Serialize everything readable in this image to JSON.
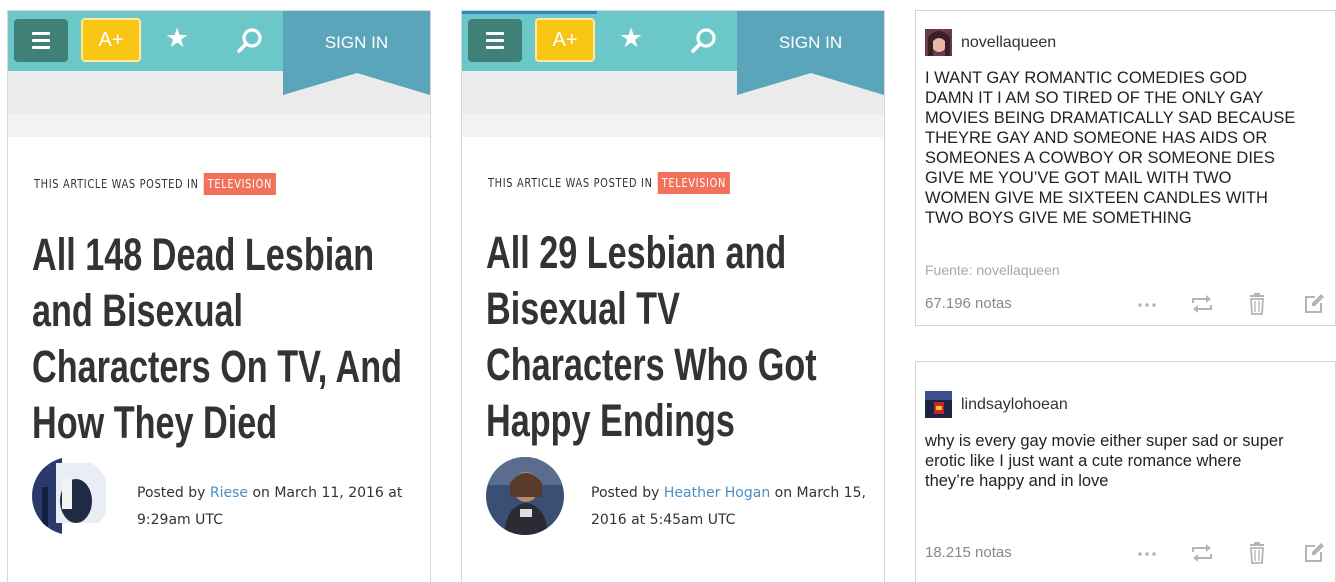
{
  "articles": [
    {
      "nav": {
        "aplus_label": "A+",
        "signin_label": "SIGN IN"
      },
      "posted_in_label": "THIS ARTICLE WAS POSTED IN",
      "category": "TELEVISION",
      "title_lines": [
        "All 148 Dead Lesbian",
        "and Bisexual",
        "Characters On TV, And",
        "How They Died"
      ],
      "byline": {
        "prefix": "Posted by ",
        "author": "Riese",
        "suffix": " on March 11, 2016 at 9:29am UTC"
      }
    },
    {
      "nav": {
        "aplus_label": "A+",
        "signin_label": "SIGN IN"
      },
      "posted_in_label": "THIS ARTICLE WAS POSTED IN",
      "category": "TELEVISION",
      "title_lines": [
        "All 29 Lesbian and",
        "Bisexual TV",
        "Characters Who Got",
        "Happy Endings"
      ],
      "byline": {
        "prefix": "Posted by ",
        "author": "Heather Hogan",
        "suffix": " on March 15, 2016 at 5:45am UTC"
      }
    }
  ],
  "posts": [
    {
      "username": "novellaqueen",
      "text_lines": [
        "I WANT GAY ROMANTIC COMEDIES GOD",
        "DAMN IT I AM SO TIRED OF THE ONLY GAY",
        "MOVIES BEING DRAMATICALLY SAD BECAUSE",
        "THEYRE GAY AND SOMEONE HAS AIDS OR",
        "SOMEONES A COWBOY OR SOMEONE DIES",
        "GIVE ME YOU’VE GOT MAIL WITH TWO",
        "WOMEN GIVE ME SIXTEEN CANDLES WITH",
        "TWO BOYS GIVE ME SOMETHING"
      ],
      "source": "Fuente: novellaqueen",
      "notes": "67.196 notas",
      "actions": [
        "more-icon",
        "reblog-icon",
        "trash-icon",
        "edit-icon"
      ]
    },
    {
      "username": "lindsaylohoean",
      "text_lines": [
        "why is every gay movie either super sad or super",
        "erotic like I just want a cute romance where",
        "they’re happy and in love"
      ],
      "notes": "18.215 notas",
      "actions": [
        "more-icon",
        "reblog-icon",
        "trash-icon",
        "edit-icon"
      ]
    }
  ],
  "colors": {
    "nav_bg": "#6cc7c9",
    "menu_button": "#3f8077",
    "aplus_button": "#f9c515",
    "signin_banner": "#5aa5ba",
    "category_tag": "#f2715b",
    "author_link": "#4a8ec9",
    "page_progress": "#2e86c7"
  }
}
